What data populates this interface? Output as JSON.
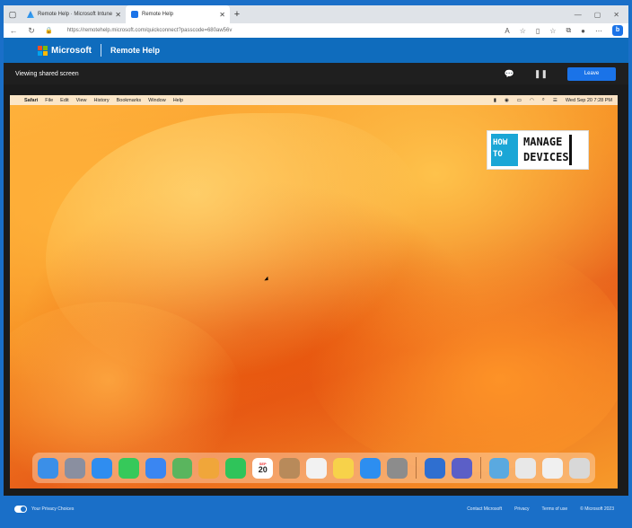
{
  "browser": {
    "tabs": [
      {
        "label": "Remote Help · Microsoft Intune",
        "active": false
      },
      {
        "label": "Remote Help",
        "active": true
      }
    ],
    "new_tab_icon": "+",
    "window_controls": [
      "minimize-icon",
      "maximize-icon",
      "close-icon"
    ],
    "url": "https://remotehelp.microsoft.com/quickconnect?passcode=680aw56v"
  },
  "header": {
    "brand": "Microsoft",
    "app_title": "Remote Help",
    "logo_colors": [
      "#f25022",
      "#7fba00",
      "#00a4ef",
      "#ffb900"
    ]
  },
  "session": {
    "label": "Viewing shared screen",
    "leave_label": "Leave"
  },
  "mac": {
    "menus": [
      "Safari",
      "File",
      "Edit",
      "View",
      "History",
      "Bookmarks",
      "Window",
      "Help"
    ],
    "clock": "Wed Sep 20  7:28 PM",
    "watermark": {
      "left": [
        "HOW",
        "TO"
      ],
      "right": [
        "MANAGE",
        "DEVICES"
      ]
    },
    "calendar": {
      "month": "SEP",
      "day": "20"
    },
    "dock_apps": [
      {
        "name": "finder",
        "color": "#3b8fe8"
      },
      {
        "name": "launchpad",
        "color": "#8a8fa0"
      },
      {
        "name": "safari",
        "color": "#2f8df0"
      },
      {
        "name": "messages",
        "color": "#36c95a"
      },
      {
        "name": "mail",
        "color": "#3a86f2"
      },
      {
        "name": "maps",
        "color": "#5ab55e"
      },
      {
        "name": "photos",
        "color": "#f0a63a"
      },
      {
        "name": "facetime",
        "color": "#2fc45a"
      },
      {
        "name": "calendar",
        "color": "#ffffff"
      },
      {
        "name": "contacts",
        "color": "#b88a5a"
      },
      {
        "name": "reminders",
        "color": "#f2f2f2"
      },
      {
        "name": "notes",
        "color": "#f7d24a"
      },
      {
        "name": "app-store",
        "color": "#2d8ef0"
      },
      {
        "name": "system-settings",
        "color": "#8c8c8c"
      },
      {
        "name": "remote-help",
        "color": "#2f6fd0"
      },
      {
        "name": "teams",
        "color": "#5b5fc7"
      },
      {
        "name": "folder",
        "color": "#5aa9e0"
      },
      {
        "name": "document",
        "color": "#e8e8e8"
      },
      {
        "name": "window",
        "color": "#f0f0f0"
      },
      {
        "name": "trash",
        "color": "#d8d8d8"
      }
    ]
  },
  "footer": {
    "privacy": "Your Privacy Choices",
    "links": [
      "Contact Microsoft",
      "Privacy",
      "Terms of use",
      "© Microsoft 2023"
    ]
  }
}
